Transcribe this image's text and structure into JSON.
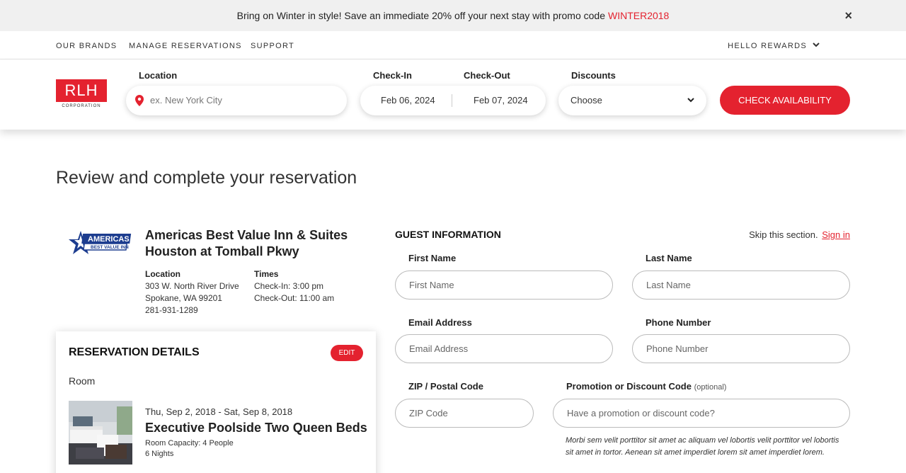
{
  "promo": {
    "text": "Bring on Winter in style! Save an immediate 20% off your next stay with promo code",
    "code": "WINTER2018",
    "close": "×"
  },
  "nav": {
    "brands": "OUR BRANDS",
    "manage": "MANAGE RESERVATIONS",
    "support": "SUPPORT",
    "rewards": "HELLO REWARDS"
  },
  "search": {
    "logo_text": "RLH",
    "logo_sub": "CORPORATION",
    "location_label": "Location",
    "location_placeholder": "ex. New York City",
    "checkin_label": "Check-In",
    "checkout_label": "Check-Out",
    "checkin_value": "Feb 06, 2024",
    "checkout_value": "Feb 07, 2024",
    "discounts_label": "Discounts",
    "discounts_value": "Choose",
    "check_button": "CHECK AVAILABILITY"
  },
  "page": {
    "title": "Review and complete your reservation"
  },
  "hotel": {
    "logo_top": "AMERICAS",
    "logo_bottom": "BEST VALUE INN",
    "name_line1": "Americas Best Value Inn & Suites",
    "name_line2": "Houston at Tomball Pkwy",
    "location_head": "Location",
    "address1": "303 W. North River Drive",
    "address2": "Spokane, WA 99201",
    "phone": "281-931-1289",
    "times_head": "Times",
    "checkin": "Check-In: 3:00 pm",
    "checkout": "Check-Out: 11:00 am"
  },
  "reservation": {
    "title": "RESERVATION DETAILS",
    "edit": "EDIT",
    "room_label": "Room",
    "dates": "Thu, Sep 2, 2018 - Sat, Sep 8, 2018",
    "room_name": "Executive Poolside Two Queen Beds",
    "capacity": "Room Capacity: 4 People",
    "nights": "6 Nights"
  },
  "guest": {
    "title": "GUEST INFORMATION",
    "skip": "Skip this section.",
    "sign_in": "Sign in",
    "first_label": "First Name",
    "first_placeholder": "First Name",
    "last_label": "Last Name",
    "last_placeholder": "Last Name",
    "email_label": "Email Address",
    "email_placeholder": "Email Address",
    "phone_label": "Phone Number",
    "phone_placeholder": "Phone Number",
    "zip_label": "ZIP / Postal Code",
    "zip_placeholder": "ZIP Code",
    "promo_label": "Promotion or Discount Code",
    "promo_optional": "(optional)",
    "promo_placeholder": "Have a promotion or discount code?",
    "promo_note": "Morbi sem velit porttitor sit amet ac aliquam vel lobortis velit porttitor vel lobortis sit amet in tortor. Aenean sit amet imperdiet lorem sit amet imperdiet lorem."
  },
  "colors": {
    "accent": "#e4222f",
    "promo_bg": "#f0f0f0"
  },
  "icons": [
    "close-icon",
    "chevron-down-icon",
    "location-pin-icon"
  ]
}
